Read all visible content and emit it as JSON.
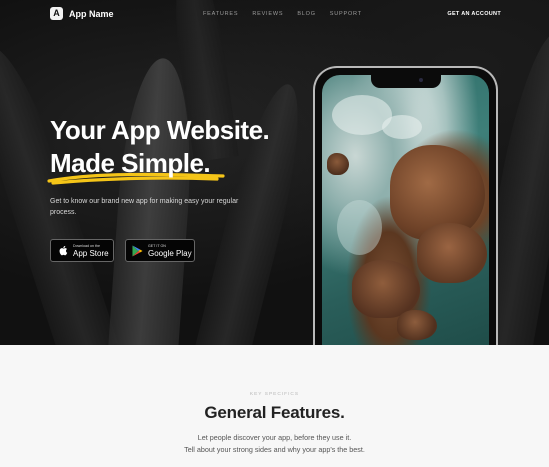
{
  "nav": {
    "brand_name": "App Name",
    "brand_logo_letter": "A",
    "links": [
      "FEATURES",
      "REVIEWS",
      "BLOG",
      "SUPPORT"
    ],
    "cta": "GET AN ACCOUNT"
  },
  "hero": {
    "headline": "Your App Website.",
    "subhead": "Made Simple.",
    "tagline": "Get to know our brand new app for making easy your regular process.",
    "highlight_color": "#f5c518",
    "app_store": {
      "small": "Download on the",
      "big": "App Store",
      "icon": "apple-icon"
    },
    "google_play": {
      "small": "GET IT ON",
      "big": "Google Play",
      "icon": "google-play-icon"
    }
  },
  "features": {
    "eyebrow": "KEY SPECIFICS",
    "title": "General Features.",
    "desc_line1": "Let people discover your app, before they use it.",
    "desc_line2": "Tell about your strong sides and why your app's the best."
  }
}
